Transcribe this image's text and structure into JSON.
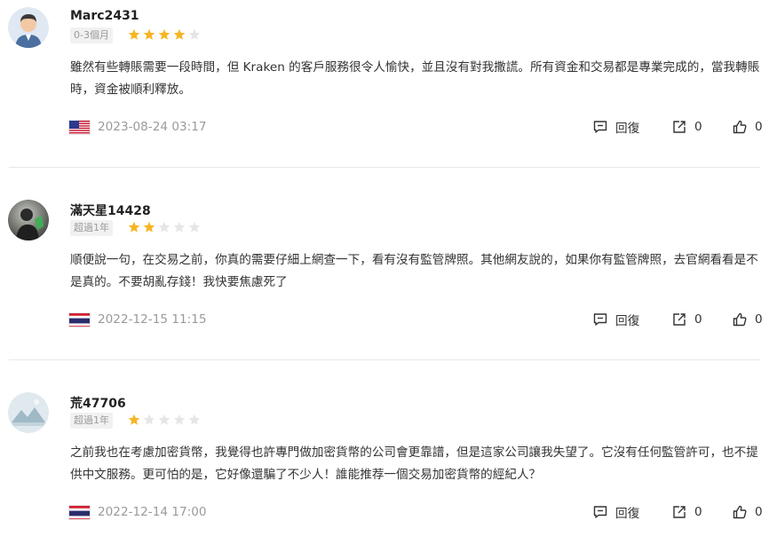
{
  "reviews": [
    {
      "username": "Marc2431",
      "tenure": "0-3個月",
      "rating": 4,
      "max_rating": 5,
      "avatar_icon": "person-avatar-icon",
      "text": "雖然有些轉賬需要一段時間，但 Kraken 的客戶服務很令人愉快，並且沒有對我撒謊。所有資金和交易都是專業完成的，當我轉賬時，資金被順利釋放。",
      "flag_icon": "us-flag-icon",
      "date": "2023-08-24 03:17",
      "reply_label": "回復",
      "share_count": "0",
      "like_count": "0"
    },
    {
      "username": "滿天星14428",
      "tenure": "超過1年",
      "rating": 2,
      "max_rating": 5,
      "avatar_icon": "photo-avatar-icon",
      "text": "順便說一句，在交易之前，你真的需要仔細上網查一下，看有沒有監管牌照。其他網友說的，如果你有監管牌照，去官網看看是不是真的。不要胡亂存錢！我快要焦慮死了",
      "flag_icon": "thailand-flag-icon",
      "date": "2022-12-15 11:15",
      "reply_label": "回復",
      "share_count": "0",
      "like_count": "0"
    },
    {
      "username": "荒47706",
      "tenure": "超過1年",
      "rating": 1,
      "max_rating": 5,
      "avatar_icon": "landscape-avatar-icon",
      "text": "之前我也在考慮加密貨幣，我覺得也許專門做加密貨幣的公司會更靠譜，但是這家公司讓我失望了。它沒有任何監管許可，也不提供中文服務。更可怕的是，它好像還騙了不少人！誰能推荐一個交易加密貨幣的經紀人？",
      "flag_icon": "thailand-flag-icon",
      "date": "2022-12-14 17:00",
      "reply_label": "回復",
      "share_count": "0",
      "like_count": "0"
    }
  ],
  "colors": {
    "star_filled": "#f6b623",
    "star_empty": "#e6e6e6",
    "meta_text": "#9a9a9a",
    "divider": "#e8e8e8"
  }
}
